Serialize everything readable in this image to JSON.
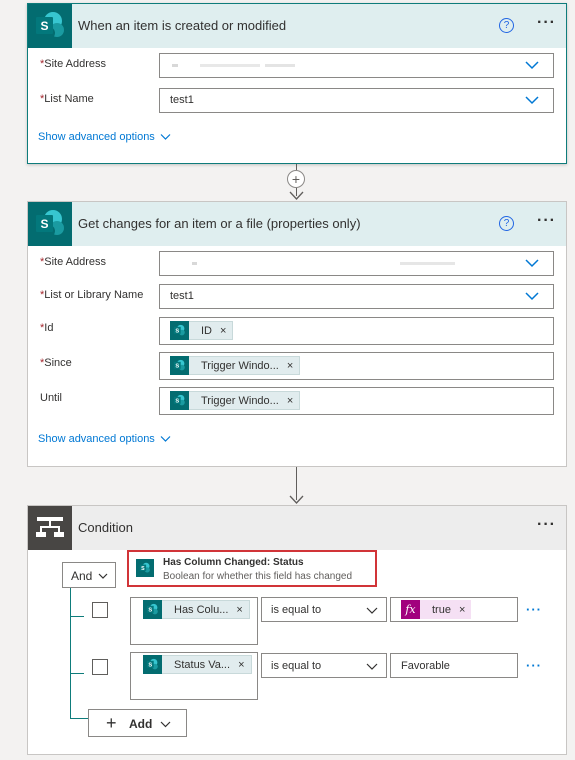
{
  "trigger": {
    "title": "When an item is created or modified",
    "help_icon": "?",
    "more_icon": "···",
    "site_address_label": "Site Address",
    "list_name_label": "List Name",
    "list_name_value": "test1",
    "advanced_label": "Show advanced options",
    "required_mark": "*"
  },
  "add_step_icon": "+",
  "get_changes": {
    "title": "Get changes for an item or a file (properties only)",
    "help_icon": "?",
    "more_icon": "···",
    "site_address_label": "Site Address",
    "list_label": "List or Library Name",
    "list_value": "test1",
    "id_label": "Id",
    "id_token": "ID",
    "since_label": "Since",
    "since_token": "Trigger Windo...",
    "until_label": "Until",
    "until_token": "Trigger Windo...",
    "advanced_label": "Show advanced options",
    "remove_icon": "×",
    "required_mark": "*"
  },
  "condition": {
    "title": "Condition",
    "more_icon": "···",
    "group_operator": "And",
    "highlight_title": "Has Column Changed: Status",
    "highlight_desc": "Boolean for whether this field has changed",
    "rows": [
      {
        "operand": "Has Colu...",
        "operator": "is equal to",
        "value": "true"
      },
      {
        "operand": "Status Va...",
        "operator": "is equal to",
        "value": "Favorable"
      }
    ],
    "row_more": "···",
    "fx_icon": "fx",
    "remove_icon": "×",
    "add_label": "Add",
    "add_icon": "+"
  },
  "colors": {
    "sharepoint_teal": "#036c70",
    "accent_blue": "#0078d4",
    "highlight_red": "#d13438",
    "fx_magenta": "#a1007d"
  }
}
